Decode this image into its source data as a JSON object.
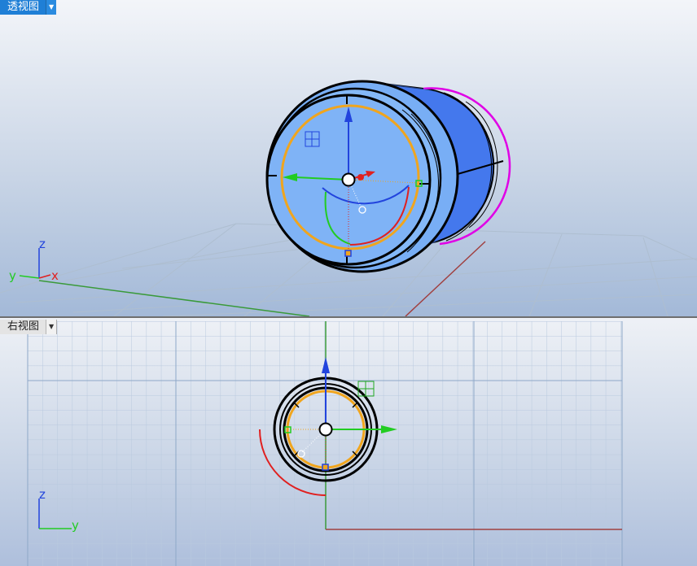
{
  "viewports": [
    {
      "title": "透视图",
      "active": true
    },
    {
      "title": "右视图",
      "active": false
    }
  ],
  "perspective_axes": {
    "z": "z",
    "y": "y",
    "x": "x"
  },
  "right_axes": {
    "z": "z",
    "y": "y"
  },
  "icons": {
    "dropdown": "chevron-down-icon",
    "gumball": "gumball-icon",
    "snap_marker": "point-marker-icon"
  },
  "colors": {
    "active_tab": "#1f7fd6",
    "cylinder_fill": "#6ea6f4",
    "cylinder_body": "#3f73ea",
    "selection_orange": "#f0a51e",
    "edge_magenta": "#e000e6",
    "axis_x": "#e02020",
    "axis_y": "#22cc22",
    "axis_z": "#2244dd",
    "world_x": "#a04040",
    "world_y": "#3a9a3a"
  }
}
